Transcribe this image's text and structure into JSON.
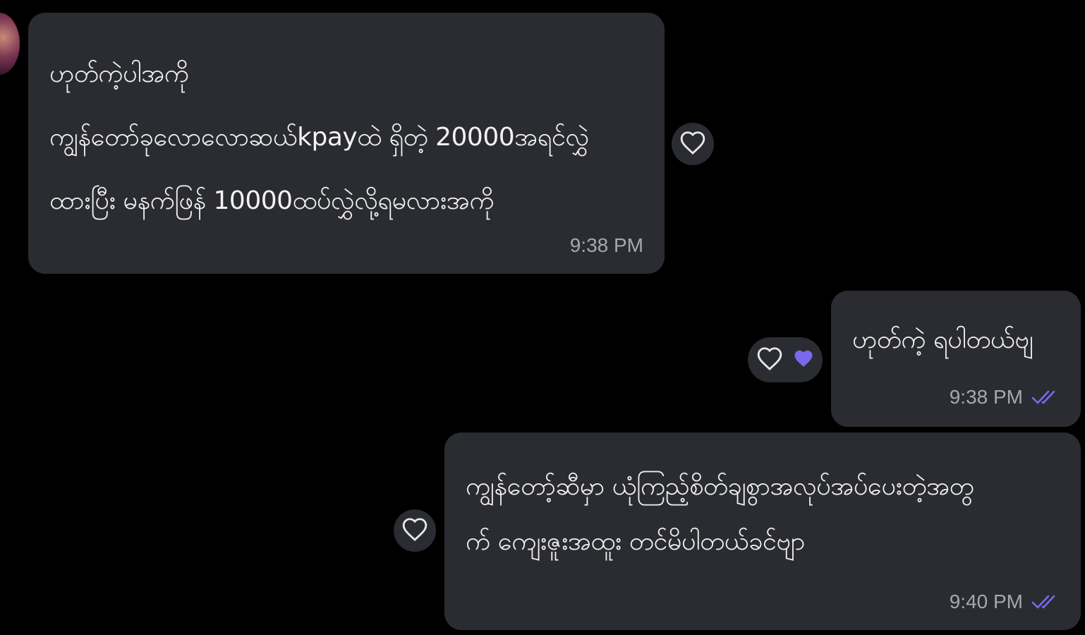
{
  "conversation": {
    "incoming": {
      "lines": [
        "ဟုတ်ကဲ့ပါအကို",
        "ကျွန်တော်ခုလောလောဆယ်kpayထဲ ရှိတဲ့ 20000အရင်လွှဲ",
        "ထားပြီး မနက်ဖြန် 10000ထပ်လွှဲလို့ရမလားအကို"
      ],
      "time": "9:38 PM"
    },
    "outgoing_1": {
      "lines": [
        "ဟုတ်ကဲ့ ရပါတယ်ဗျ"
      ],
      "time": "9:38 PM",
      "status": "read"
    },
    "outgoing_2": {
      "lines": [
        "ကျွန်တော့်ဆီမှာ ယုံကြည့်စိတ်ချစွာအလုပ်အပ်ပေးတဲ့အတွ",
        "က် ကျေးဇူးအထူး တင်မိပါတယ်ခင်ဗျာ"
      ],
      "time": "9:40 PM",
      "status": "read"
    }
  },
  "icons": {
    "react": "heart-outline-icon",
    "reacted": "heart-filled-icon",
    "read": "double-check-icon"
  },
  "colors": {
    "background": "#000000",
    "bubble": "#2b2c31",
    "text": "#f2f2f2",
    "meta": "#a7a8ad",
    "accent": "#7b68ee"
  }
}
